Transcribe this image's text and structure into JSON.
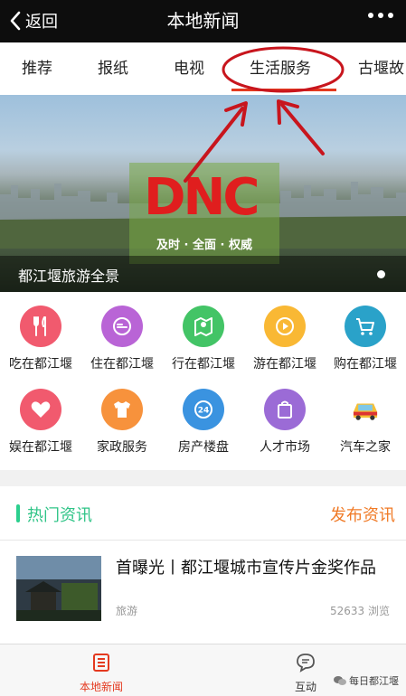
{
  "header": {
    "back_label": "返回",
    "title": "本地新闻"
  },
  "tabs": [
    {
      "label": "推荐"
    },
    {
      "label": "报纸"
    },
    {
      "label": "电视"
    },
    {
      "label": "生活服务",
      "selected": true
    },
    {
      "label": "古堰故"
    }
  ],
  "banner": {
    "logo_text": "DNC",
    "slogan": "及时 · 全面 · 权威",
    "caption": "都江堰旅游全景"
  },
  "services": [
    {
      "label": "吃在都江堰",
      "icon": "fork-knife-icon",
      "color": "#f15a6e"
    },
    {
      "label": "住在都江堰",
      "icon": "bed-icon",
      "color": "#b964d6"
    },
    {
      "label": "行在都江堰",
      "icon": "map-pin-icon",
      "color": "#43c466"
    },
    {
      "label": "游在都江堰",
      "icon": "play-icon",
      "color": "#f9b834"
    },
    {
      "label": "购在都江堰",
      "icon": "cart-icon",
      "color": "#2aa2c9"
    },
    {
      "label": "娱在都江堰",
      "icon": "heart-icon",
      "color": "#f15a6e"
    },
    {
      "label": "家政服务",
      "icon": "shirt-icon",
      "color": "#f7923c"
    },
    {
      "label": "房产楼盘",
      "icon": "phone-24-icon",
      "color": "#3a93e0"
    },
    {
      "label": "人才市场",
      "icon": "bag-icon",
      "color": "#9b6bd6"
    },
    {
      "label": "汽车之家",
      "icon": "car-icon",
      "color": "#f5c037"
    }
  ],
  "hot": {
    "title": "热门资讯",
    "publish_label": "发布资讯"
  },
  "news": [
    {
      "headline": "首曝光丨都江堰城市宣传片金奖作品",
      "tag": "旅游",
      "views": "52633 浏览"
    }
  ],
  "bottom_nav": {
    "home_label": "本地新闻",
    "chat_label": "互动",
    "watermark": "每日都江堰"
  },
  "colors": {
    "accent": "#e4391f",
    "hot_green": "#2fc487",
    "publish_orange": "#f07a26"
  }
}
